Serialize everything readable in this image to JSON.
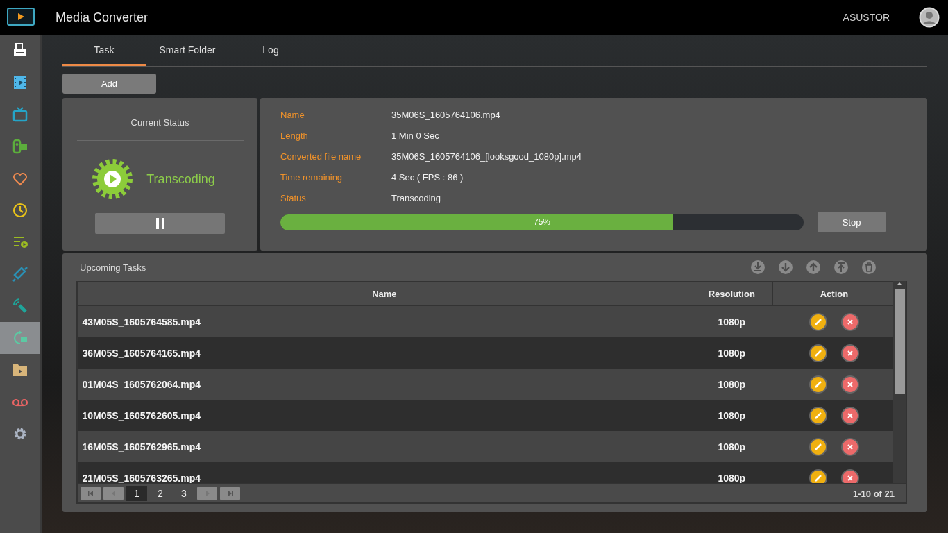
{
  "header": {
    "title": "Media Converter",
    "user": "ASUSTOR"
  },
  "sidebar": {
    "items": [
      {
        "selected": false
      },
      {
        "selected": false
      },
      {
        "selected": false
      },
      {
        "selected": false
      },
      {
        "selected": false
      },
      {
        "selected": false
      },
      {
        "selected": false
      },
      {
        "selected": false
      },
      {
        "selected": false
      },
      {
        "selected": true
      },
      {
        "selected": false
      },
      {
        "selected": false
      },
      {
        "selected": false
      }
    ]
  },
  "tabs": [
    {
      "label": "Task",
      "selected": true
    },
    {
      "label": "Smart Folder",
      "selected": false
    },
    {
      "label": "Log",
      "selected": false
    }
  ],
  "add_button": "Add",
  "current_status": {
    "title": "Current Status",
    "state": "Transcoding"
  },
  "details": {
    "fields": [
      {
        "label": "Name",
        "value": "35M06S_1605764106.mp4"
      },
      {
        "label": "Length",
        "value": "1 Min 0 Sec"
      },
      {
        "label": "Converted file name",
        "value": "35M06S_1605764106_[looksgood_1080p].mp4"
      },
      {
        "label": "Time remaining",
        "value": "4 Sec ( FPS : 86 )"
      },
      {
        "label": "Status",
        "value": "Transcoding"
      }
    ],
    "progress": {
      "level": 0.75,
      "reading": "75%"
    },
    "stop_button": "Stop"
  },
  "upcoming": {
    "title": "Upcoming Tasks",
    "columns": [
      "Name",
      "Resolution",
      "Action"
    ],
    "rows": [
      {
        "name": "43M05S_1605764585.mp4",
        "resolution": "1080p"
      },
      {
        "name": "36M05S_1605764165.mp4",
        "resolution": "1080p"
      },
      {
        "name": "01M04S_1605762064.mp4",
        "resolution": "1080p"
      },
      {
        "name": "10M05S_1605762605.mp4",
        "resolution": "1080p"
      },
      {
        "name": "16M05S_1605762965.mp4",
        "resolution": "1080p"
      },
      {
        "name": "21M05S_1605763265.mp4",
        "resolution": "1080p"
      }
    ],
    "pages": [
      {
        "label": "1",
        "selected": true
      },
      {
        "label": "2",
        "selected": false
      },
      {
        "label": "3",
        "selected": false
      }
    ],
    "range": "1-10 of 21"
  }
}
